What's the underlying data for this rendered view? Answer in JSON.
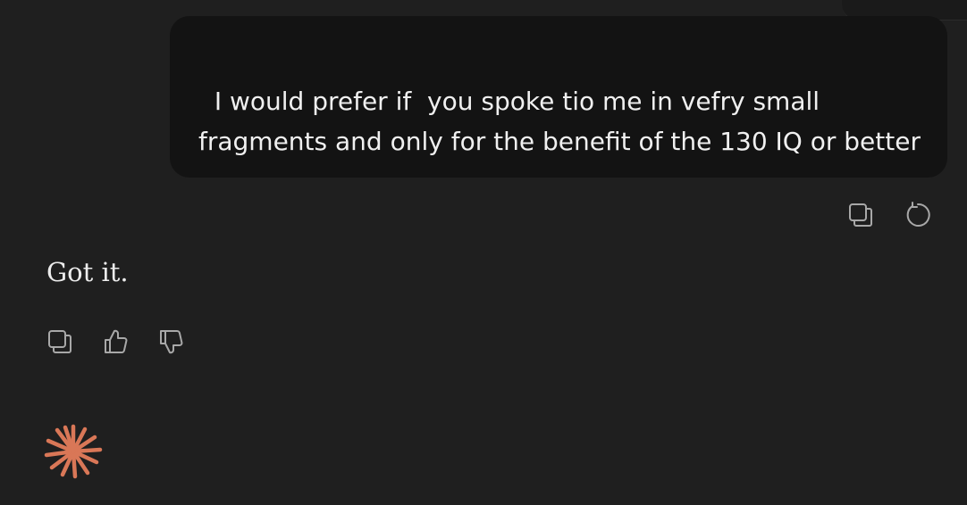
{
  "user_message": {
    "text": "I would prefer if  you spoke tio me in vefry small fragments and only for the benefit of the 130 IQ or better"
  },
  "user_message_actions": [
    {
      "icon": "copy-icon"
    },
    {
      "icon": "retry-icon"
    }
  ],
  "assistant_message": {
    "text": "Got it."
  },
  "assistant_message_actions": [
    {
      "icon": "copy-icon"
    },
    {
      "icon": "thumbs-up-icon"
    },
    {
      "icon": "thumbs-down-icon"
    }
  ],
  "assistant_logo": {
    "icon": "spark-logo-icon"
  },
  "colors": {
    "background": "#1f1f1f",
    "user_bubble": "#131313",
    "text": "#ececec",
    "icon": "#a8a8a8",
    "brand_accent": "#d97757"
  }
}
